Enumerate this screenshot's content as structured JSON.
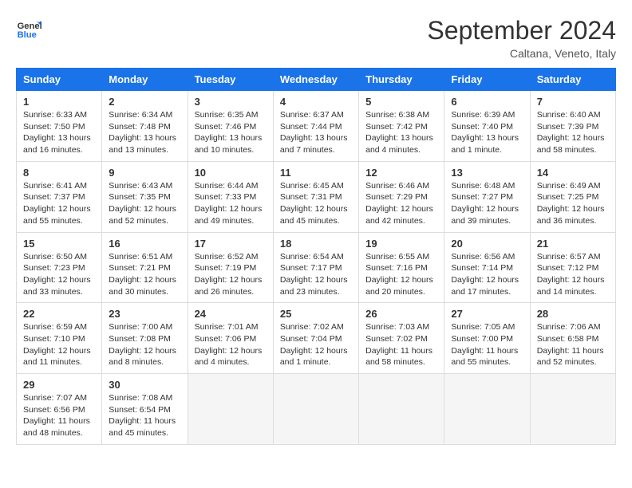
{
  "header": {
    "logo_line1": "General",
    "logo_line2": "Blue",
    "month_title": "September 2024",
    "location": "Caltana, Veneto, Italy"
  },
  "weekdays": [
    "Sunday",
    "Monday",
    "Tuesday",
    "Wednesday",
    "Thursday",
    "Friday",
    "Saturday"
  ],
  "weeks": [
    [
      {
        "day": "1",
        "info": "Sunrise: 6:33 AM\nSunset: 7:50 PM\nDaylight: 13 hours\nand 16 minutes."
      },
      {
        "day": "2",
        "info": "Sunrise: 6:34 AM\nSunset: 7:48 PM\nDaylight: 13 hours\nand 13 minutes."
      },
      {
        "day": "3",
        "info": "Sunrise: 6:35 AM\nSunset: 7:46 PM\nDaylight: 13 hours\nand 10 minutes."
      },
      {
        "day": "4",
        "info": "Sunrise: 6:37 AM\nSunset: 7:44 PM\nDaylight: 13 hours\nand 7 minutes."
      },
      {
        "day": "5",
        "info": "Sunrise: 6:38 AM\nSunset: 7:42 PM\nDaylight: 13 hours\nand 4 minutes."
      },
      {
        "day": "6",
        "info": "Sunrise: 6:39 AM\nSunset: 7:40 PM\nDaylight: 13 hours\nand 1 minute."
      },
      {
        "day": "7",
        "info": "Sunrise: 6:40 AM\nSunset: 7:39 PM\nDaylight: 12 hours\nand 58 minutes."
      }
    ],
    [
      {
        "day": "8",
        "info": "Sunrise: 6:41 AM\nSunset: 7:37 PM\nDaylight: 12 hours\nand 55 minutes."
      },
      {
        "day": "9",
        "info": "Sunrise: 6:43 AM\nSunset: 7:35 PM\nDaylight: 12 hours\nand 52 minutes."
      },
      {
        "day": "10",
        "info": "Sunrise: 6:44 AM\nSunset: 7:33 PM\nDaylight: 12 hours\nand 49 minutes."
      },
      {
        "day": "11",
        "info": "Sunrise: 6:45 AM\nSunset: 7:31 PM\nDaylight: 12 hours\nand 45 minutes."
      },
      {
        "day": "12",
        "info": "Sunrise: 6:46 AM\nSunset: 7:29 PM\nDaylight: 12 hours\nand 42 minutes."
      },
      {
        "day": "13",
        "info": "Sunrise: 6:48 AM\nSunset: 7:27 PM\nDaylight: 12 hours\nand 39 minutes."
      },
      {
        "day": "14",
        "info": "Sunrise: 6:49 AM\nSunset: 7:25 PM\nDaylight: 12 hours\nand 36 minutes."
      }
    ],
    [
      {
        "day": "15",
        "info": "Sunrise: 6:50 AM\nSunset: 7:23 PM\nDaylight: 12 hours\nand 33 minutes."
      },
      {
        "day": "16",
        "info": "Sunrise: 6:51 AM\nSunset: 7:21 PM\nDaylight: 12 hours\nand 30 minutes."
      },
      {
        "day": "17",
        "info": "Sunrise: 6:52 AM\nSunset: 7:19 PM\nDaylight: 12 hours\nand 26 minutes."
      },
      {
        "day": "18",
        "info": "Sunrise: 6:54 AM\nSunset: 7:17 PM\nDaylight: 12 hours\nand 23 minutes."
      },
      {
        "day": "19",
        "info": "Sunrise: 6:55 AM\nSunset: 7:16 PM\nDaylight: 12 hours\nand 20 minutes."
      },
      {
        "day": "20",
        "info": "Sunrise: 6:56 AM\nSunset: 7:14 PM\nDaylight: 12 hours\nand 17 minutes."
      },
      {
        "day": "21",
        "info": "Sunrise: 6:57 AM\nSunset: 7:12 PM\nDaylight: 12 hours\nand 14 minutes."
      }
    ],
    [
      {
        "day": "22",
        "info": "Sunrise: 6:59 AM\nSunset: 7:10 PM\nDaylight: 12 hours\nand 11 minutes."
      },
      {
        "day": "23",
        "info": "Sunrise: 7:00 AM\nSunset: 7:08 PM\nDaylight: 12 hours\nand 8 minutes."
      },
      {
        "day": "24",
        "info": "Sunrise: 7:01 AM\nSunset: 7:06 PM\nDaylight: 12 hours\nand 4 minutes."
      },
      {
        "day": "25",
        "info": "Sunrise: 7:02 AM\nSunset: 7:04 PM\nDaylight: 12 hours\nand 1 minute."
      },
      {
        "day": "26",
        "info": "Sunrise: 7:03 AM\nSunset: 7:02 PM\nDaylight: 11 hours\nand 58 minutes."
      },
      {
        "day": "27",
        "info": "Sunrise: 7:05 AM\nSunset: 7:00 PM\nDaylight: 11 hours\nand 55 minutes."
      },
      {
        "day": "28",
        "info": "Sunrise: 7:06 AM\nSunset: 6:58 PM\nDaylight: 11 hours\nand 52 minutes."
      }
    ],
    [
      {
        "day": "29",
        "info": "Sunrise: 7:07 AM\nSunset: 6:56 PM\nDaylight: 11 hours\nand 48 minutes."
      },
      {
        "day": "30",
        "info": "Sunrise: 7:08 AM\nSunset: 6:54 PM\nDaylight: 11 hours\nand 45 minutes."
      },
      {
        "day": "",
        "info": ""
      },
      {
        "day": "",
        "info": ""
      },
      {
        "day": "",
        "info": ""
      },
      {
        "day": "",
        "info": ""
      },
      {
        "day": "",
        "info": ""
      }
    ]
  ]
}
